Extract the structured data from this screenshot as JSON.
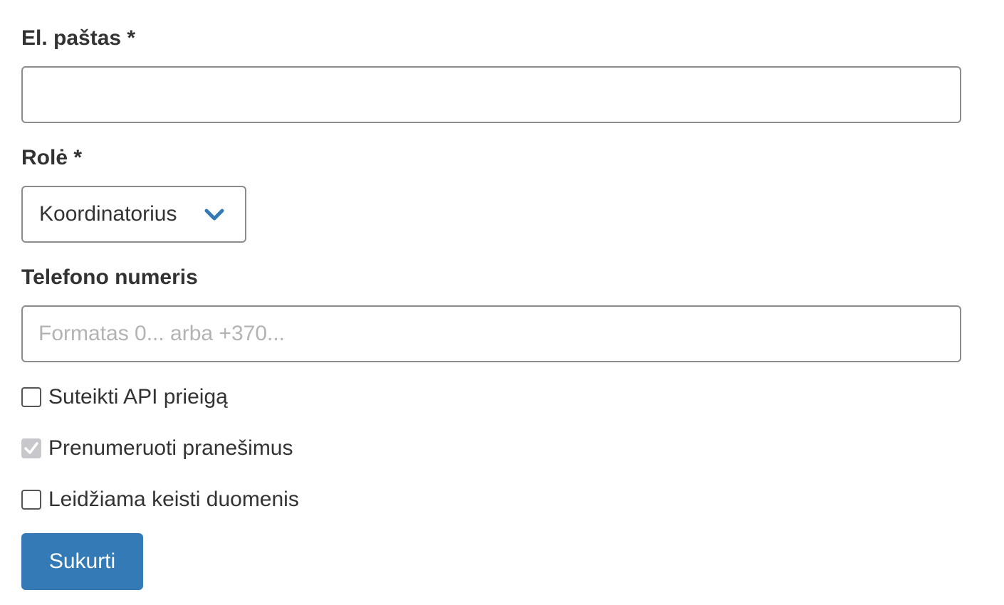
{
  "form": {
    "email": {
      "label": "El. paštas *",
      "value": "",
      "placeholder": ""
    },
    "role": {
      "label": "Rolė *",
      "selected": "Koordinatorius",
      "chevron_icon": "chevron-down-icon",
      "chevron_color": "#337ab7"
    },
    "phone": {
      "label": "Telefono numeris",
      "value": "",
      "placeholder": "Formatas 0... arba +370..."
    },
    "checkboxes": [
      {
        "label": "Suteikti API prieigą",
        "checked": false,
        "disabled": false
      },
      {
        "label": "Prenumeruoti pranešimus",
        "checked": true,
        "disabled": true
      },
      {
        "label": "Leidžiama keisti duomenis",
        "checked": false,
        "disabled": false
      }
    ],
    "submit": {
      "label": "Sukurti",
      "color": "#337ab7"
    }
  }
}
